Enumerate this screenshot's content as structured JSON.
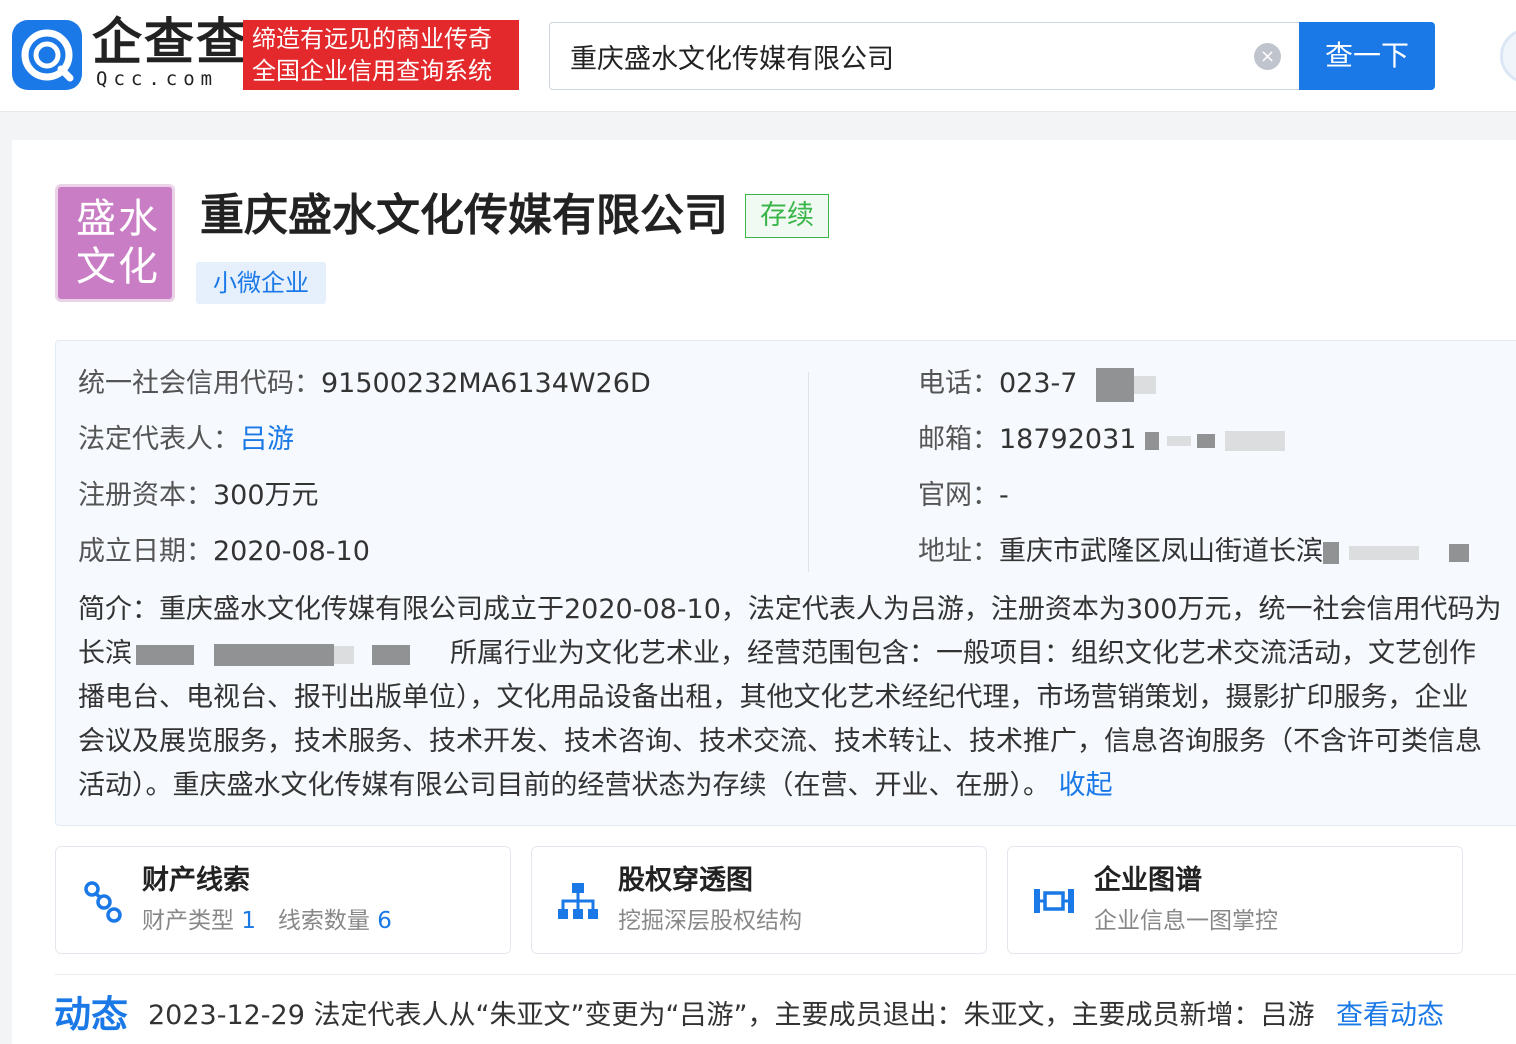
{
  "header": {
    "logo_cn": "企查查",
    "logo_en": "Qcc.com",
    "slogan_line1": "缔造有远见的商业传奇",
    "slogan_line2": "全国企业信用查询系统",
    "search_value": "重庆盛水文化传媒有限公司",
    "search_button": "查一下"
  },
  "company": {
    "logo_line1": "盛水",
    "logo_line2": "文化",
    "name": "重庆盛水文化传媒有限公司",
    "status": "存续",
    "scale_tag": "小微企业"
  },
  "info": {
    "credit_code_label": "统一社会信用代码：",
    "credit_code": "91500232MA6134W26D",
    "legal_rep_label": "法定代表人：",
    "legal_rep": "吕游",
    "capital_label": "注册资本：",
    "capital": "300万元",
    "founded_label": "成立日期：",
    "founded": "2020-08-10",
    "phone_label": "电话：",
    "phone": "023-7",
    "email_label": "邮箱：",
    "email": "18792031",
    "website_label": "官网：",
    "website": "-",
    "address_label": "地址：",
    "address": "重庆市武隆区凤山街道长滨"
  },
  "intro": {
    "line1": "简介：重庆盛水文化传媒有限公司成立于2020-08-10，法定代表人为吕游，注册资本为300万元，统一社会信用代码为",
    "line2_prefix": "长滨",
    "line2_rest": "所属行业为文化艺术业，经营范围包含：一般项目：组织文化艺术交流活动，文艺创作",
    "line3": "播电台、电视台、报刊出版单位），文化用品设备出租，其他文化艺术经纪代理，市场营销策划，摄影扩印服务，企业",
    "line4": "会议及展览服务，技术服务、技术开发、技术咨询、技术交流、技术转让、技术推广，信息咨询服务（不含许可类信息",
    "line5": "活动）。重庆盛水文化传媒有限公司目前的经营状态为存续（在营、开业、在册）。",
    "collapse": "收起"
  },
  "features": [
    {
      "title": "财产线索",
      "sub1": "财产类型",
      "num1": "1",
      "sub2": "线索数量",
      "num2": "6"
    },
    {
      "title": "股权穿透图",
      "sub": "挖掘深层股权结构"
    },
    {
      "title": "企业图谱",
      "sub": "企业信息一图掌控"
    }
  ],
  "dynamics": {
    "title": "动态",
    "text": "2023-12-29 法定代表人从“朱亚文”变更为“吕游”，主要成员退出：朱亚文，主要成员新增：吕游",
    "link": "查看动态"
  },
  "colors": {
    "brand_blue": "#1a79e6",
    "slogan_red": "#e3292b",
    "status_green": "#3ab54a",
    "logo_purple": "#c97dc4"
  }
}
